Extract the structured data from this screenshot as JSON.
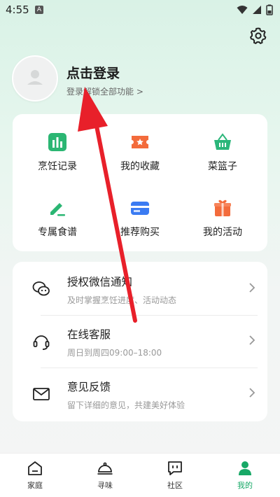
{
  "status_bar": {
    "time": "4:55",
    "notification_badge": "A"
  },
  "header": {
    "login_title": "点击登录",
    "login_subtitle": "登录解锁全部功能 >"
  },
  "features": [
    {
      "label": "烹饪记录",
      "icon": "chart-bars-icon",
      "color": "#2bb673"
    },
    {
      "label": "我的收藏",
      "icon": "ticket-star-icon",
      "color": "#f36b3b"
    },
    {
      "label": "菜篮子",
      "icon": "basket-icon",
      "color": "#2bb67a"
    },
    {
      "label": "专属食谱",
      "icon": "pen-icon",
      "color": "#2bb673"
    },
    {
      "label": "推荐购买",
      "icon": "card-icon",
      "color": "#3b7bf2"
    },
    {
      "label": "我的活动",
      "icon": "gift-icon",
      "color": "#f36b3b"
    }
  ],
  "settings_list": [
    {
      "title": "授权微信通知",
      "desc": "及时掌握烹饪进度、活动动态",
      "icon": "wechat-icon"
    },
    {
      "title": "在线客服",
      "desc": "周日到周四09:00–18:00",
      "icon": "headset-icon"
    },
    {
      "title": "意见反馈",
      "desc": "留下详细的意见，共建美好体验",
      "icon": "mail-icon"
    }
  ],
  "tabs": [
    {
      "label": "家庭",
      "icon": "home-icon",
      "active": false
    },
    {
      "label": "寻味",
      "icon": "cloche-icon",
      "active": false
    },
    {
      "label": "社区",
      "icon": "chat-icon",
      "active": false
    },
    {
      "label": "我的",
      "icon": "user-icon",
      "active": true
    }
  ],
  "colors": {
    "accent": "#17a866",
    "annotation_arrow": "#e8202a"
  }
}
